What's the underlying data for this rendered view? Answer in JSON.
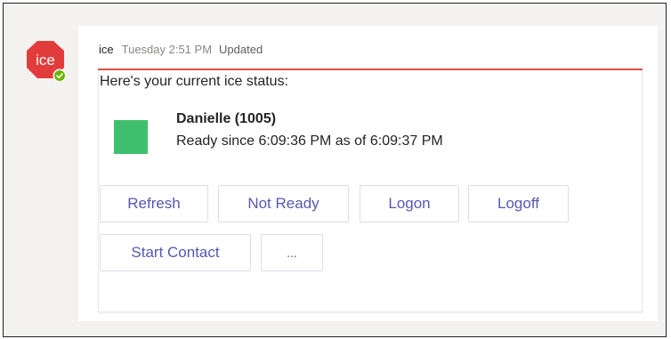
{
  "app": {
    "avatar_text": "ice"
  },
  "message": {
    "author": "ice",
    "timestamp": "Tuesday 2:51 PM",
    "edited_label": "Updated"
  },
  "card": {
    "intro": "Here's your current ice status:",
    "agent_name": "Danielle (1005)",
    "agent_status": "Ready since 6:09:36 PM as of 6:09:37 PM",
    "status_color": "#3fbf6d"
  },
  "actions": {
    "refresh": "Refresh",
    "not_ready": "Not Ready",
    "logon": "Logon",
    "logoff": "Logoff",
    "start_contact": "Start Contact",
    "more": "..."
  },
  "colors": {
    "accent": "#e04a4a",
    "button_text": "#5558af",
    "presence": "#6bb700"
  },
  "icons": {
    "avatar": "ice-logo-icon",
    "presence": "available-check-icon"
  }
}
